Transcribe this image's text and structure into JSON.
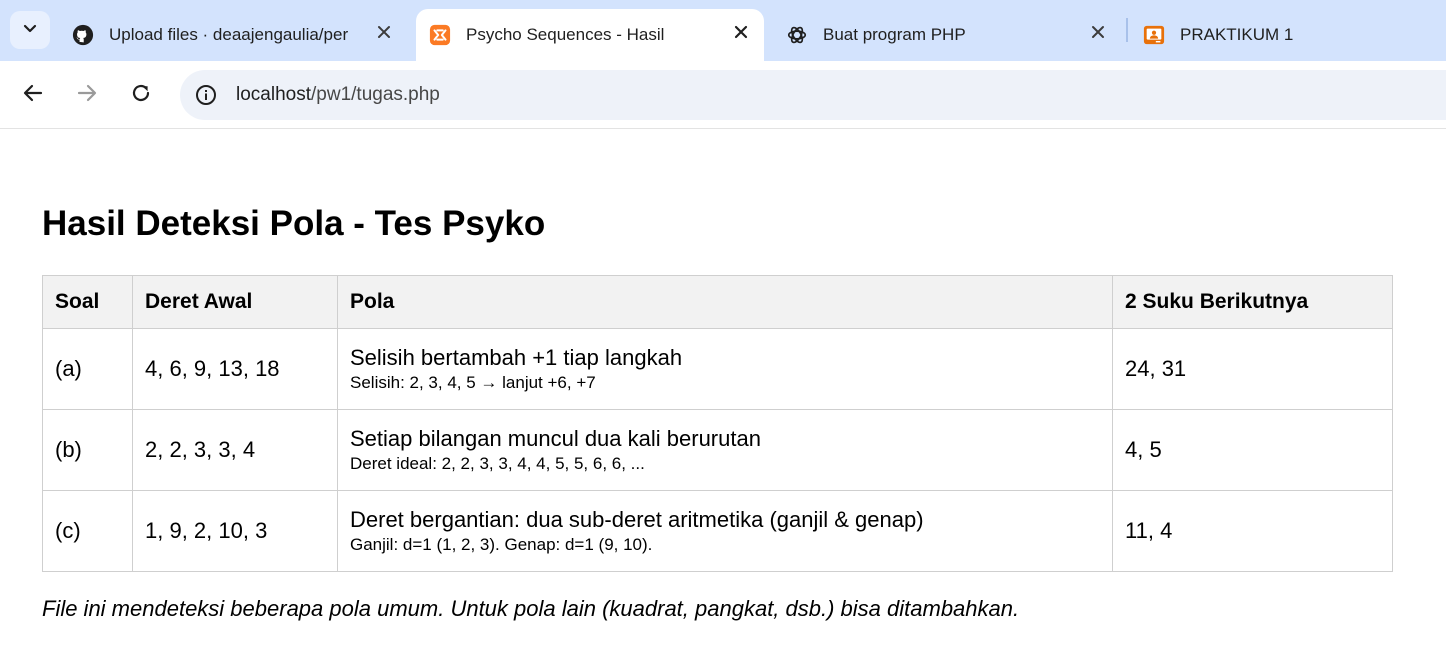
{
  "browser": {
    "tabs": [
      {
        "title": "Upload files · deaajengaulia/per",
        "favicon": "github-icon",
        "active": false
      },
      {
        "title": "Psycho Sequences - Hasil",
        "favicon": "xampp-icon",
        "active": true
      },
      {
        "title": "Buat program PHP",
        "favicon": "chatgpt-icon",
        "active": false
      },
      {
        "title": "PRAKTIKUM 1",
        "favicon": "classroom-icon",
        "active": false
      }
    ],
    "address": {
      "host": "localhost",
      "path": "/pw1/tugas.php"
    }
  },
  "page": {
    "heading": "Hasil Deteksi Pola - Tes Psyko",
    "table": {
      "headers": [
        "Soal",
        "Deret Awal",
        "Pola",
        "2 Suku Berikutnya"
      ],
      "rows": [
        {
          "soal": "(a)",
          "deret": "4, 6, 9, 13, 18",
          "pola": "Selisih bertambah +1 tiap langkah",
          "detail": "Selisih: 2, 3, 4, 5 → lanjut +6, +7",
          "next": "24, 31"
        },
        {
          "soal": "(b)",
          "deret": "2, 2, 3, 3, 4",
          "pola": "Setiap bilangan muncul dua kali berurutan",
          "detail": "Deret ideal: 2, 2, 3, 3, 4, 4, 5, 5, 6, 6, ...",
          "next": "4, 5"
        },
        {
          "soal": "(c)",
          "deret": "1, 9, 2, 10, 3",
          "pola": "Deret bergantian: dua sub-deret aritmetika (ganjil & genap)",
          "detail": "Ganjil: d=1 (1, 2, 3). Genap: d=1 (9, 10).",
          "next": "11, 4"
        }
      ]
    },
    "note": "File ini mendeteksi beberapa pola umum. Untuk pola lain (kuadrat, pangkat, dsb.) bisa ditambahkan."
  }
}
